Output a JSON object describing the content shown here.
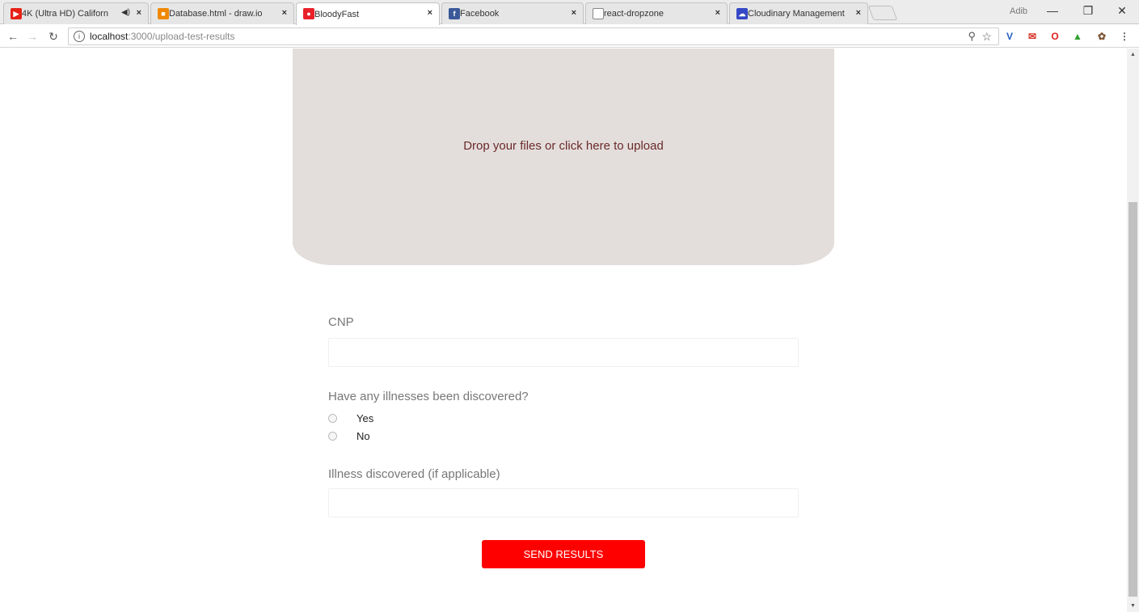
{
  "browser": {
    "tabs": [
      {
        "title": "4K (Ultra HD) Californ",
        "icon": "youtube-icon",
        "color": "#e62117"
      },
      {
        "title": "Database.html - draw.io",
        "icon": "drawio-icon",
        "color": "#f08705"
      },
      {
        "title": "BloodyFast",
        "icon": "bloodyfast-icon",
        "color": "#e8202a"
      },
      {
        "title": "Facebook",
        "icon": "facebook-icon",
        "color": "#3b5998"
      },
      {
        "title": "react-dropzone",
        "icon": "page-icon",
        "color": "#888888"
      },
      {
        "title": "Cloudinary Management",
        "icon": "cloudinary-icon",
        "color": "#3448c5"
      }
    ],
    "active_tab": 2,
    "profile_label": "Adib",
    "url_host": "localhost",
    "url_path": ":3000/upload-test-results",
    "extensions": [
      "vimium-icon",
      "gmail-icon",
      "opera-icon",
      "new-ext-icon",
      "paw-icon",
      "menu-icon"
    ]
  },
  "page": {
    "dropzone_text": "Drop your files or click here to upload",
    "cnp_label": "CNP",
    "cnp_value": "",
    "illness_question": "Have any illnesses been discovered?",
    "options": [
      "Yes",
      "No"
    ],
    "illness_label": "Illness discovered (if applicable)",
    "illness_value": "",
    "submit_label": "SEND RESULTS"
  },
  "colors": {
    "accent": "#ff0000",
    "dropzone_bg": "#e3dedc",
    "dropzone_text": "#6b2a2a"
  }
}
